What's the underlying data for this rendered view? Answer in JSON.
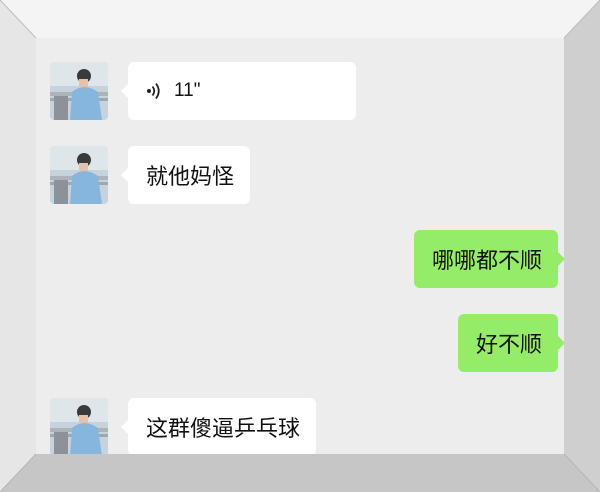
{
  "messages": [
    {
      "side": "left",
      "type": "voice",
      "duration": "11\""
    },
    {
      "side": "left",
      "type": "text",
      "text": "就他妈怪"
    },
    {
      "side": "right",
      "type": "text",
      "text": "哪哪都不顺"
    },
    {
      "side": "right",
      "type": "text",
      "text": "好不顺"
    },
    {
      "side": "left",
      "type": "text",
      "text": "这群傻逼乒乓球"
    }
  ],
  "colors": {
    "chat_background": "#ededed",
    "incoming_bubble": "#ffffff",
    "outgoing_bubble": "#95ec69",
    "frame": "#dcdcdc"
  },
  "icons": {
    "voice": "voice-wave-icon",
    "avatar": "avatar-photo"
  }
}
